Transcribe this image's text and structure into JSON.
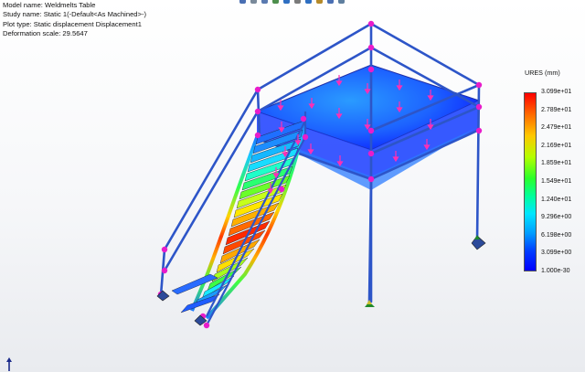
{
  "info": {
    "model_name": "Model name: Weldmelts Table",
    "study_name": "Study name: Static 1(-Default<As Machined>-)",
    "plot_type": "Plot type: Static displacement Displacement1",
    "deformation_scale": "Deformation scale: 29.5647"
  },
  "legend": {
    "title": "URES (mm)",
    "labels": [
      "3.099e+01",
      "2.789e+01",
      "2.479e+01",
      "2.169e+01",
      "1.859e+01",
      "1.549e+01",
      "1.240e+01",
      "9.296e+00",
      "6.198e+00",
      "3.099e+00",
      "1.000e-30"
    ]
  },
  "toolbar": {
    "icons": [
      "zoom-to-fit-icon",
      "zoom-area-icon",
      "previous-view-icon",
      "section-view-icon",
      "view-orientation-icon",
      "display-style-icon",
      "hide-show-icon",
      "edit-appearance-icon",
      "apply-scene-icon",
      "view-settings-icon"
    ]
  },
  "colors": {
    "frame_blue": "#2d55c8",
    "load_arrow": "#ff2fb5",
    "node": "#e81ccb",
    "fixture": "#1f8a2a"
  }
}
